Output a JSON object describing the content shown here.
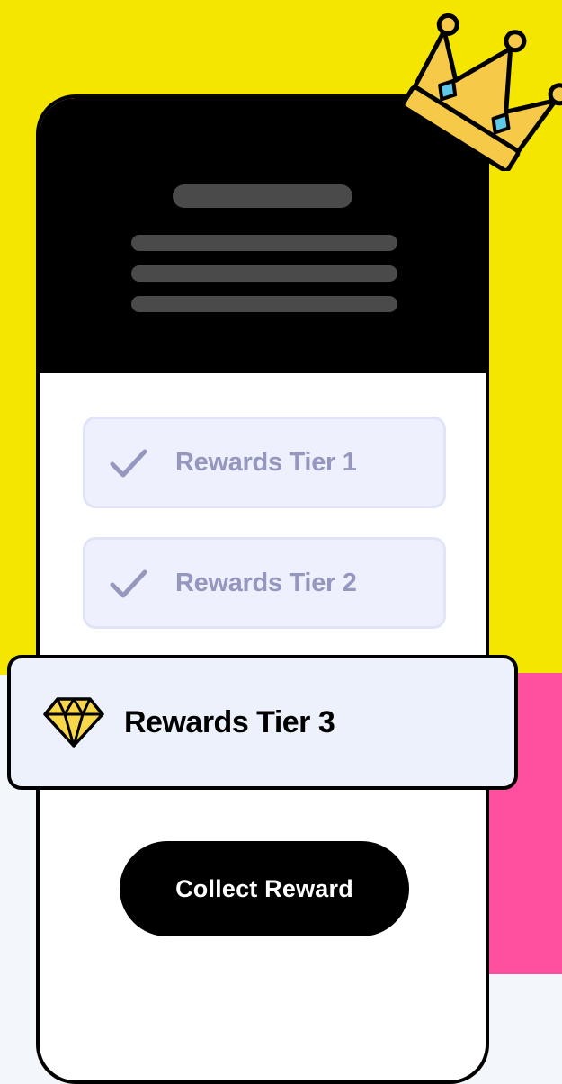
{
  "rewards": {
    "tiers": [
      {
        "label": "Rewards Tier 1",
        "completed": true
      },
      {
        "label": "Rewards Tier 2",
        "completed": true
      },
      {
        "label": "Rewards Tier 3",
        "completed": false
      }
    ],
    "collect_label": "Collect Reward"
  },
  "icons": {
    "completed": "check-icon",
    "current_tier": "diamond-icon",
    "decoration": "crown-icon"
  },
  "colors": {
    "background_top": "#f5e600",
    "accent_pink": "#ff509f",
    "tier_text_muted": "#9597bf",
    "tier_background": "#eef1fd",
    "button": "#000000",
    "gold": "#f7c948",
    "gem": "#5ec8e8"
  }
}
